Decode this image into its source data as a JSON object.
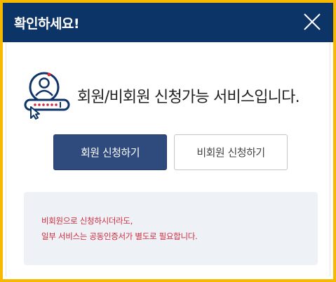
{
  "dialog": {
    "title": "확인하세요!",
    "message": "회원/비회원 신청가능 서비스입니다.",
    "buttons": {
      "member_label": "회원 신청하기",
      "nonmember_label": "비회원 신청하기"
    },
    "notice": {
      "line1": "비회원으로 신청하시더라도,",
      "line2": "일부 서비스는 공동인증서가 별도로 필요합니다."
    }
  },
  "icons": {
    "close": "close-icon",
    "service": "user-login-icon"
  },
  "colors": {
    "header": "#0d3466",
    "frame_border": "#f7b800",
    "primary_button": "#2f4a7c",
    "notice_text": "#d12a3c",
    "notice_background": "#eef2f6"
  }
}
